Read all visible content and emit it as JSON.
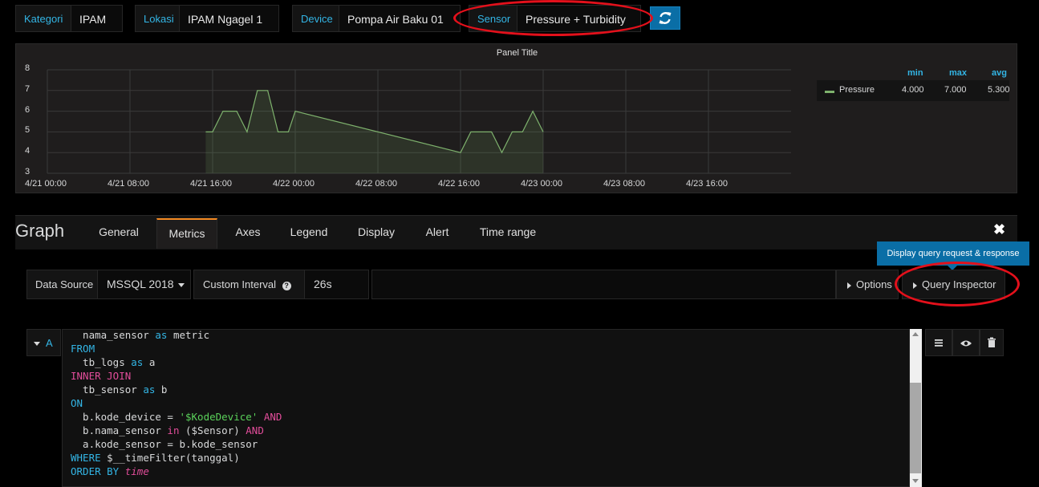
{
  "variables": [
    {
      "label": "Kategori",
      "value": "IPAM"
    },
    {
      "label": "Lokasi",
      "value": "IPAM Ngagel 1"
    },
    {
      "label": "Device",
      "value": "Pompa Air Baku 01"
    },
    {
      "label": "Sensor",
      "value": "Pressure + Turbidity"
    }
  ],
  "panel": {
    "title": "Panel Title",
    "legend": {
      "headers": {
        "min": "min",
        "max": "max",
        "avg": "avg"
      },
      "series": {
        "name": "Pressure",
        "min": "4.000",
        "max": "7.000",
        "avg": "5.300"
      }
    }
  },
  "chart_data": {
    "type": "line",
    "title": "Panel Title",
    "ylim": [
      3,
      8
    ],
    "y_ticks": [
      "8",
      "7",
      "6",
      "5",
      "4",
      "3"
    ],
    "x_ticks": [
      "4/21 00:00",
      "4/21 08:00",
      "4/21 16:00",
      "4/22 00:00",
      "4/22 08:00",
      "4/22 16:00",
      "4/23 00:00",
      "4/23 08:00",
      "4/23 16:00"
    ],
    "series": [
      {
        "name": "Pressure",
        "color": "#7eb26d",
        "x": [
          "4/21 15:20",
          "4/21 16:00",
          "4/21 17:00",
          "4/21 18:20",
          "4/21 19:20",
          "4/21 20:20",
          "4/21 21:20",
          "4/21 22:20",
          "4/21 23:20",
          "4/22 00:00",
          "4/22 16:00",
          "4/22 17:00",
          "4/22 19:00",
          "4/22 20:00",
          "4/22 21:00",
          "4/22 22:00",
          "4/22 23:00",
          "4/23 00:00"
        ],
        "values": [
          5,
          5,
          6,
          6,
          5,
          7,
          7,
          5,
          5,
          6,
          4,
          5,
          5,
          4,
          5,
          5,
          6,
          5
        ]
      }
    ]
  },
  "editor": {
    "title": "Graph",
    "tabs": [
      "General",
      "Metrics",
      "Axes",
      "Legend",
      "Display",
      "Alert",
      "Time range"
    ],
    "active_tab": "Metrics",
    "tooltip": "Display query request & response",
    "data_source_label": "Data Source",
    "data_source_value": "MSSQL 2018",
    "custom_interval_label": "Custom Interval",
    "custom_interval_value": "26s",
    "options_label": "Options",
    "query_inspector_label": "Query Inspector",
    "query_ref": "A"
  },
  "query": {
    "l1_ident": "  nama_sensor ",
    "l1_kw": "as",
    "l1_rest": " metric",
    "l2_kw": "FROM",
    "l3_ident": "  tb_logs ",
    "l3_kw": "as",
    "l3_rest": " a",
    "l4_kw": "INNER JOIN",
    "l5_ident": "  tb_sensor ",
    "l5_kw": "as",
    "l5_rest": " b",
    "l6_kw": "ON",
    "l7_ident": "  b.kode_device = ",
    "l7_str": "'$KodeDevice'",
    "l7_kw": " AND",
    "l8_ident": "  b.nama_sensor ",
    "l8_kw": "in",
    "l8_mid": " ($Sensor) ",
    "l8_kw2": "AND",
    "l9_ident": "  a.kode_sensor = b.kode_sensor",
    "l10_kw": "WHERE",
    "l10_rest": " $__timeFilter(tanggal)",
    "l11_kw": "ORDER BY",
    "l11_rest": " time"
  },
  "colors": {
    "accent": "#33b5e5",
    "highlight": "#e3101b",
    "button": "#0a6ea6",
    "tab_active": "#f58a22",
    "series": "#7eb26d"
  }
}
